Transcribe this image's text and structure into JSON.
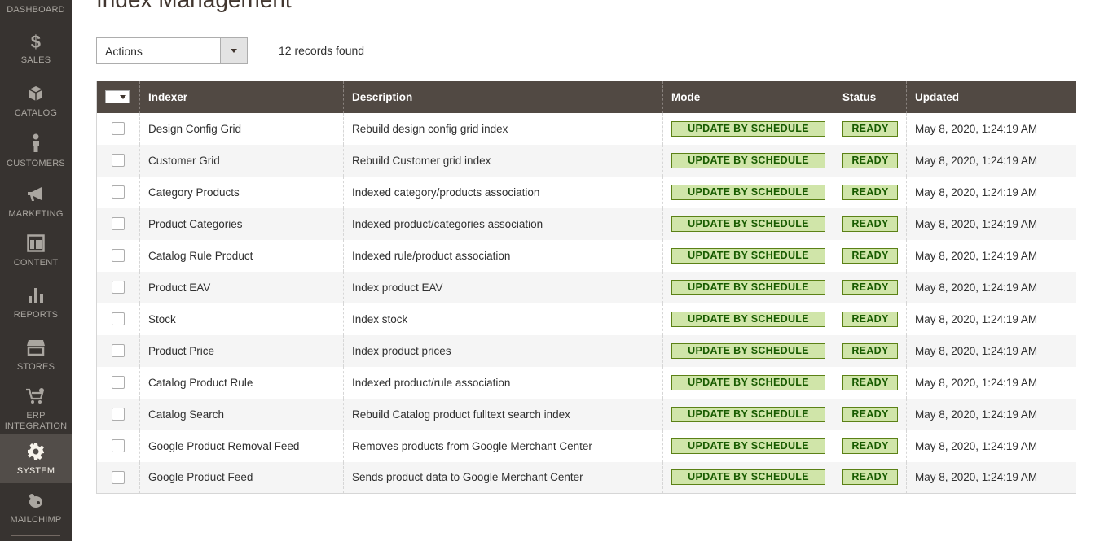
{
  "sidebar": {
    "items": [
      {
        "label": "DASHBOARD",
        "icon": "dashboard-icon"
      },
      {
        "label": "SALES",
        "icon": "dollar-icon"
      },
      {
        "label": "CATALOG",
        "icon": "cube-icon"
      },
      {
        "label": "CUSTOMERS",
        "icon": "person-icon"
      },
      {
        "label": "MARKETING",
        "icon": "megaphone-icon"
      },
      {
        "label": "CONTENT",
        "icon": "layout-icon"
      },
      {
        "label": "REPORTS",
        "icon": "bar-chart-icon"
      },
      {
        "label": "STORES",
        "icon": "store-icon"
      },
      {
        "label": "ERP",
        "label2": "INTEGRATION",
        "icon": "cart-gear-icon"
      },
      {
        "label": "SYSTEM",
        "icon": "gear-icon",
        "active": true
      },
      {
        "label": "MAILCHIMP",
        "icon": "mailchimp-icon"
      }
    ]
  },
  "page": {
    "title": "Index Management"
  },
  "toolbar": {
    "actions_label": "Actions",
    "records_found": "12 records found"
  },
  "grid": {
    "headers": [
      "Indexer",
      "Description",
      "Mode",
      "Status",
      "Updated"
    ],
    "rows": [
      {
        "indexer": "Design Config Grid",
        "description": "Rebuild design config grid index",
        "mode": "UPDATE BY SCHEDULE",
        "status": "READY",
        "updated": "May 8, 2020, 1:24:19 AM"
      },
      {
        "indexer": "Customer Grid",
        "description": "Rebuild Customer grid index",
        "mode": "UPDATE BY SCHEDULE",
        "status": "READY",
        "updated": "May 8, 2020, 1:24:19 AM"
      },
      {
        "indexer": "Category Products",
        "description": "Indexed category/products association",
        "mode": "UPDATE BY SCHEDULE",
        "status": "READY",
        "updated": "May 8, 2020, 1:24:19 AM"
      },
      {
        "indexer": "Product Categories",
        "description": "Indexed product/categories association",
        "mode": "UPDATE BY SCHEDULE",
        "status": "READY",
        "updated": "May 8, 2020, 1:24:19 AM"
      },
      {
        "indexer": "Catalog Rule Product",
        "description": "Indexed rule/product association",
        "mode": "UPDATE BY SCHEDULE",
        "status": "READY",
        "updated": "May 8, 2020, 1:24:19 AM"
      },
      {
        "indexer": "Product EAV",
        "description": "Index product EAV",
        "mode": "UPDATE BY SCHEDULE",
        "status": "READY",
        "updated": "May 8, 2020, 1:24:19 AM"
      },
      {
        "indexer": "Stock",
        "description": "Index stock",
        "mode": "UPDATE BY SCHEDULE",
        "status": "READY",
        "updated": "May 8, 2020, 1:24:19 AM"
      },
      {
        "indexer": "Product Price",
        "description": "Index product prices",
        "mode": "UPDATE BY SCHEDULE",
        "status": "READY",
        "updated": "May 8, 2020, 1:24:19 AM"
      },
      {
        "indexer": "Catalog Product Rule",
        "description": "Indexed product/rule association",
        "mode": "UPDATE BY SCHEDULE",
        "status": "READY",
        "updated": "May 8, 2020, 1:24:19 AM"
      },
      {
        "indexer": "Catalog Search",
        "description": "Rebuild Catalog product fulltext search index",
        "mode": "UPDATE BY SCHEDULE",
        "status": "READY",
        "updated": "May 8, 2020, 1:24:19 AM"
      },
      {
        "indexer": "Google Product Removal Feed",
        "description": "Removes products from Google Merchant Center",
        "mode": "UPDATE BY SCHEDULE",
        "status": "READY",
        "updated": "May 8, 2020, 1:24:19 AM"
      },
      {
        "indexer": "Google Product Feed",
        "description": "Sends product data to Google Merchant Center",
        "mode": "UPDATE BY SCHEDULE",
        "status": "READY",
        "updated": "May 8, 2020, 1:24:19 AM"
      }
    ]
  },
  "colors": {
    "sidebar_bg": "#373330",
    "sidebar_active": "#524d49",
    "header_bg": "#514943",
    "badge_bg": "#d0e5a9",
    "badge_text": "#185b00"
  }
}
